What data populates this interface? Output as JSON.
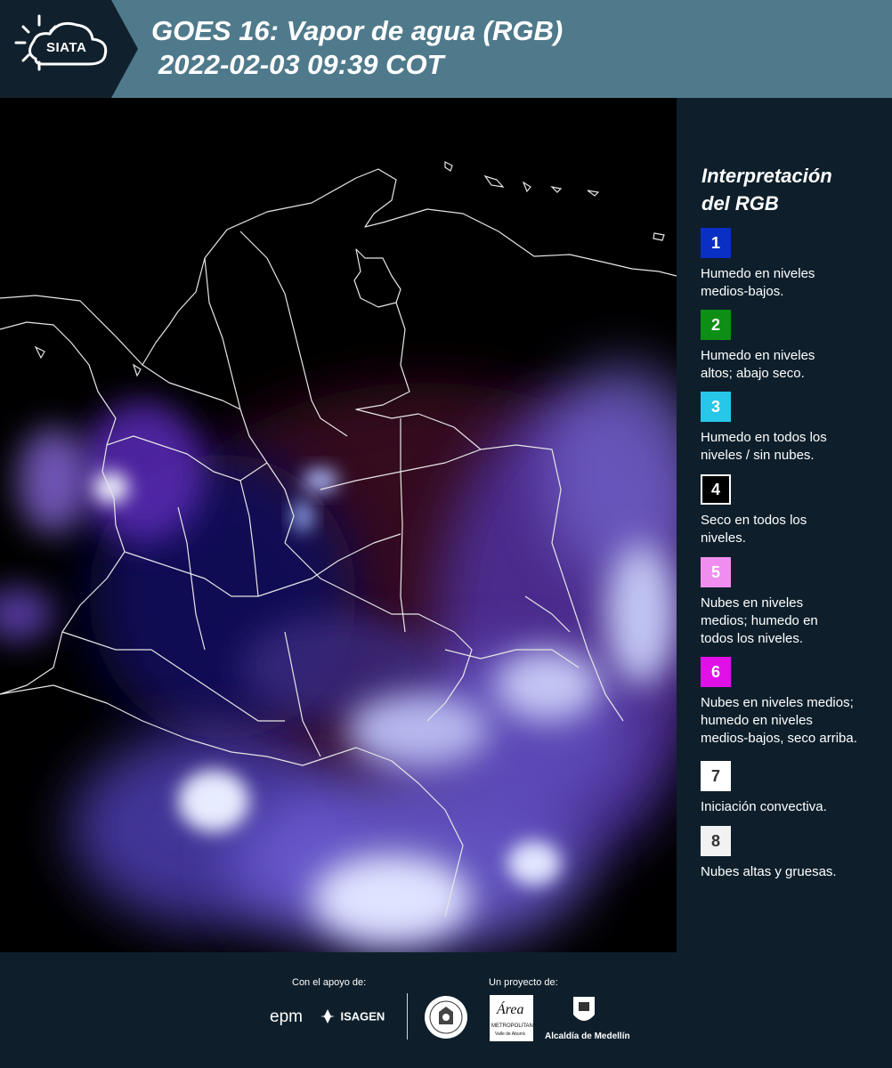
{
  "header": {
    "logo_text": "SIATA",
    "title_line1": "GOES 16: Vapor de agua (RGB)",
    "title_line2": "2022-02-03 09:39 COT"
  },
  "legend": {
    "title_line1": "Interpretación",
    "title_line2": "del RGB",
    "items": [
      {
        "number": "1",
        "label_line1": "Humedo en niveles",
        "label_line2": "medios-bajos.",
        "label_line3": "",
        "color": "#0a2fc4",
        "text_color": "#ffffff"
      },
      {
        "number": "2",
        "label_line1": "Humedo en niveles",
        "label_line2": "altos; abajo seco.",
        "label_line3": "",
        "color": "#0c8f14",
        "text_color": "#ffffff"
      },
      {
        "number": "3",
        "label_line1": "Humedo en todos los",
        "label_line2": "niveles / sin nubes.",
        "label_line3": "",
        "color": "#27c7ea",
        "text_color": "#ffffff"
      },
      {
        "number": "4",
        "label_line1": "Seco en todos los",
        "label_line2": "niveles.",
        "label_line3": "",
        "color": "#000000",
        "text_color": "#ffffff"
      },
      {
        "number": "5",
        "label_line1": "Nubes en niveles",
        "label_line2": "medios; humedo en",
        "label_line3": "todos los niveles.",
        "color": "#f08ef0",
        "text_color": "#ffffff"
      },
      {
        "number": "6",
        "label_line1": "Nubes en niveles medios;",
        "label_line2": "humedo en niveles",
        "label_line3": "medios-bajos, seco arriba.",
        "color": "#e010e6",
        "text_color": "#ffffff"
      },
      {
        "number": "7",
        "label_line1": "Iniciación convectiva.",
        "label_line2": "",
        "label_line3": "",
        "color": "#ffffff",
        "text_color": "#333333"
      },
      {
        "number": "8",
        "label_line1": "Nubes altas y gruesas.",
        "label_line2": "",
        "label_line3": "",
        "color": "#f2f2f2",
        "text_color": "#333333"
      }
    ]
  },
  "footer": {
    "support_label": "Con el apoyo de:",
    "project_label": "Un proyecto de:",
    "sponsor_epm": "epm",
    "sponsor_isagen": "ISAGEN",
    "area_text": "Área",
    "area_subtext": "METROPOLITANA",
    "area_subtext2": "Valle de Aburrá",
    "alcaldia": "Alcaldía de Medellín"
  }
}
